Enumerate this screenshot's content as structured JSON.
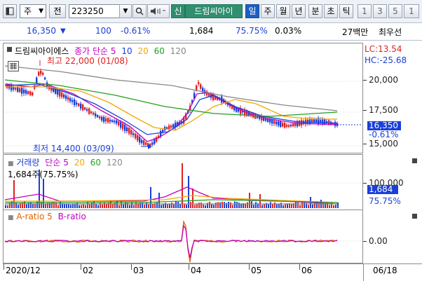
{
  "toolbar": {
    "code_type": "주",
    "jeon_label": "전",
    "stock_code": "223250",
    "stock_name_prefix": "신",
    "stock_name": "드림씨아이",
    "periods": [
      "일",
      "주",
      "월",
      "년",
      "분",
      "초",
      "틱"
    ],
    "active_period": "일",
    "counts": [
      "1",
      "3",
      "5",
      "1"
    ]
  },
  "info": {
    "price": "16,350",
    "change": "100",
    "change_pct": "-0.61%",
    "volume": "1,684",
    "volume_ratio": "75.75%",
    "turnover": "0.03%",
    "trade_value": "27백만",
    "priority": "최우선"
  },
  "price_panel": {
    "legend_name": "드림씨아이에스",
    "legend_ma_label": "종가 단순",
    "ma_periods": [
      "5",
      "10",
      "20",
      "60",
      "120"
    ],
    "ma_colors": [
      "#c000c0",
      "#1a3fd9",
      "#f0a800",
      "#22a022",
      "#888888"
    ],
    "high_label": "최고 22,000 (01/08)",
    "low_label": "최저 14,400 (03/09)",
    "lc": "LC:13.54",
    "hc": "HC:-25.68",
    "ticks": [
      "20,000",
      "17,500",
      "15,000"
    ],
    "current_price": "16,350",
    "current_pct": "-0.61%"
  },
  "volume_panel": {
    "legend_name": "거래량",
    "legend_ma_label": "단순",
    "ma_periods": [
      "5",
      "20",
      "60",
      "120"
    ],
    "volume_text": "1,684주(75.75%)",
    "tick": "100,000",
    "current": "1,684",
    "current_pct": "75.75%"
  },
  "ratio_panel": {
    "a_label": "A-ratio 5",
    "b_label": "B-ratio",
    "tick": "0.00"
  },
  "xaxis": {
    "labels": [
      "2020/12",
      "02",
      "03",
      "04",
      "05",
      "06"
    ],
    "right": "06/18"
  }
}
